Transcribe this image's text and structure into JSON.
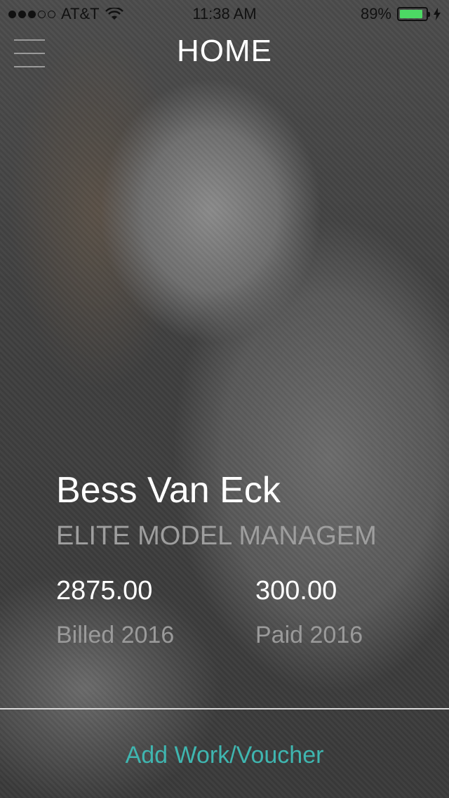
{
  "status_bar": {
    "carrier": "AT&T",
    "time": "11:38 AM",
    "battery_percent": "89%",
    "battery_level": 0.89,
    "signal_dots_filled": 3,
    "signal_dots_total": 5
  },
  "header": {
    "title": "HOME",
    "menu_icon": "hamburger-menu-icon"
  },
  "profile": {
    "name": "Bess Van Eck",
    "agency": "ELITE MODEL MANAGEM..."
  },
  "stats": {
    "billed_value": "2875.00",
    "billed_label": "Billed 2016",
    "paid_value": "300.00",
    "paid_label": "Paid 2016"
  },
  "actions": {
    "add_label": "Add Work/Voucher"
  },
  "colors": {
    "accent": "#3fb6b0",
    "battery": "#4cd964"
  }
}
